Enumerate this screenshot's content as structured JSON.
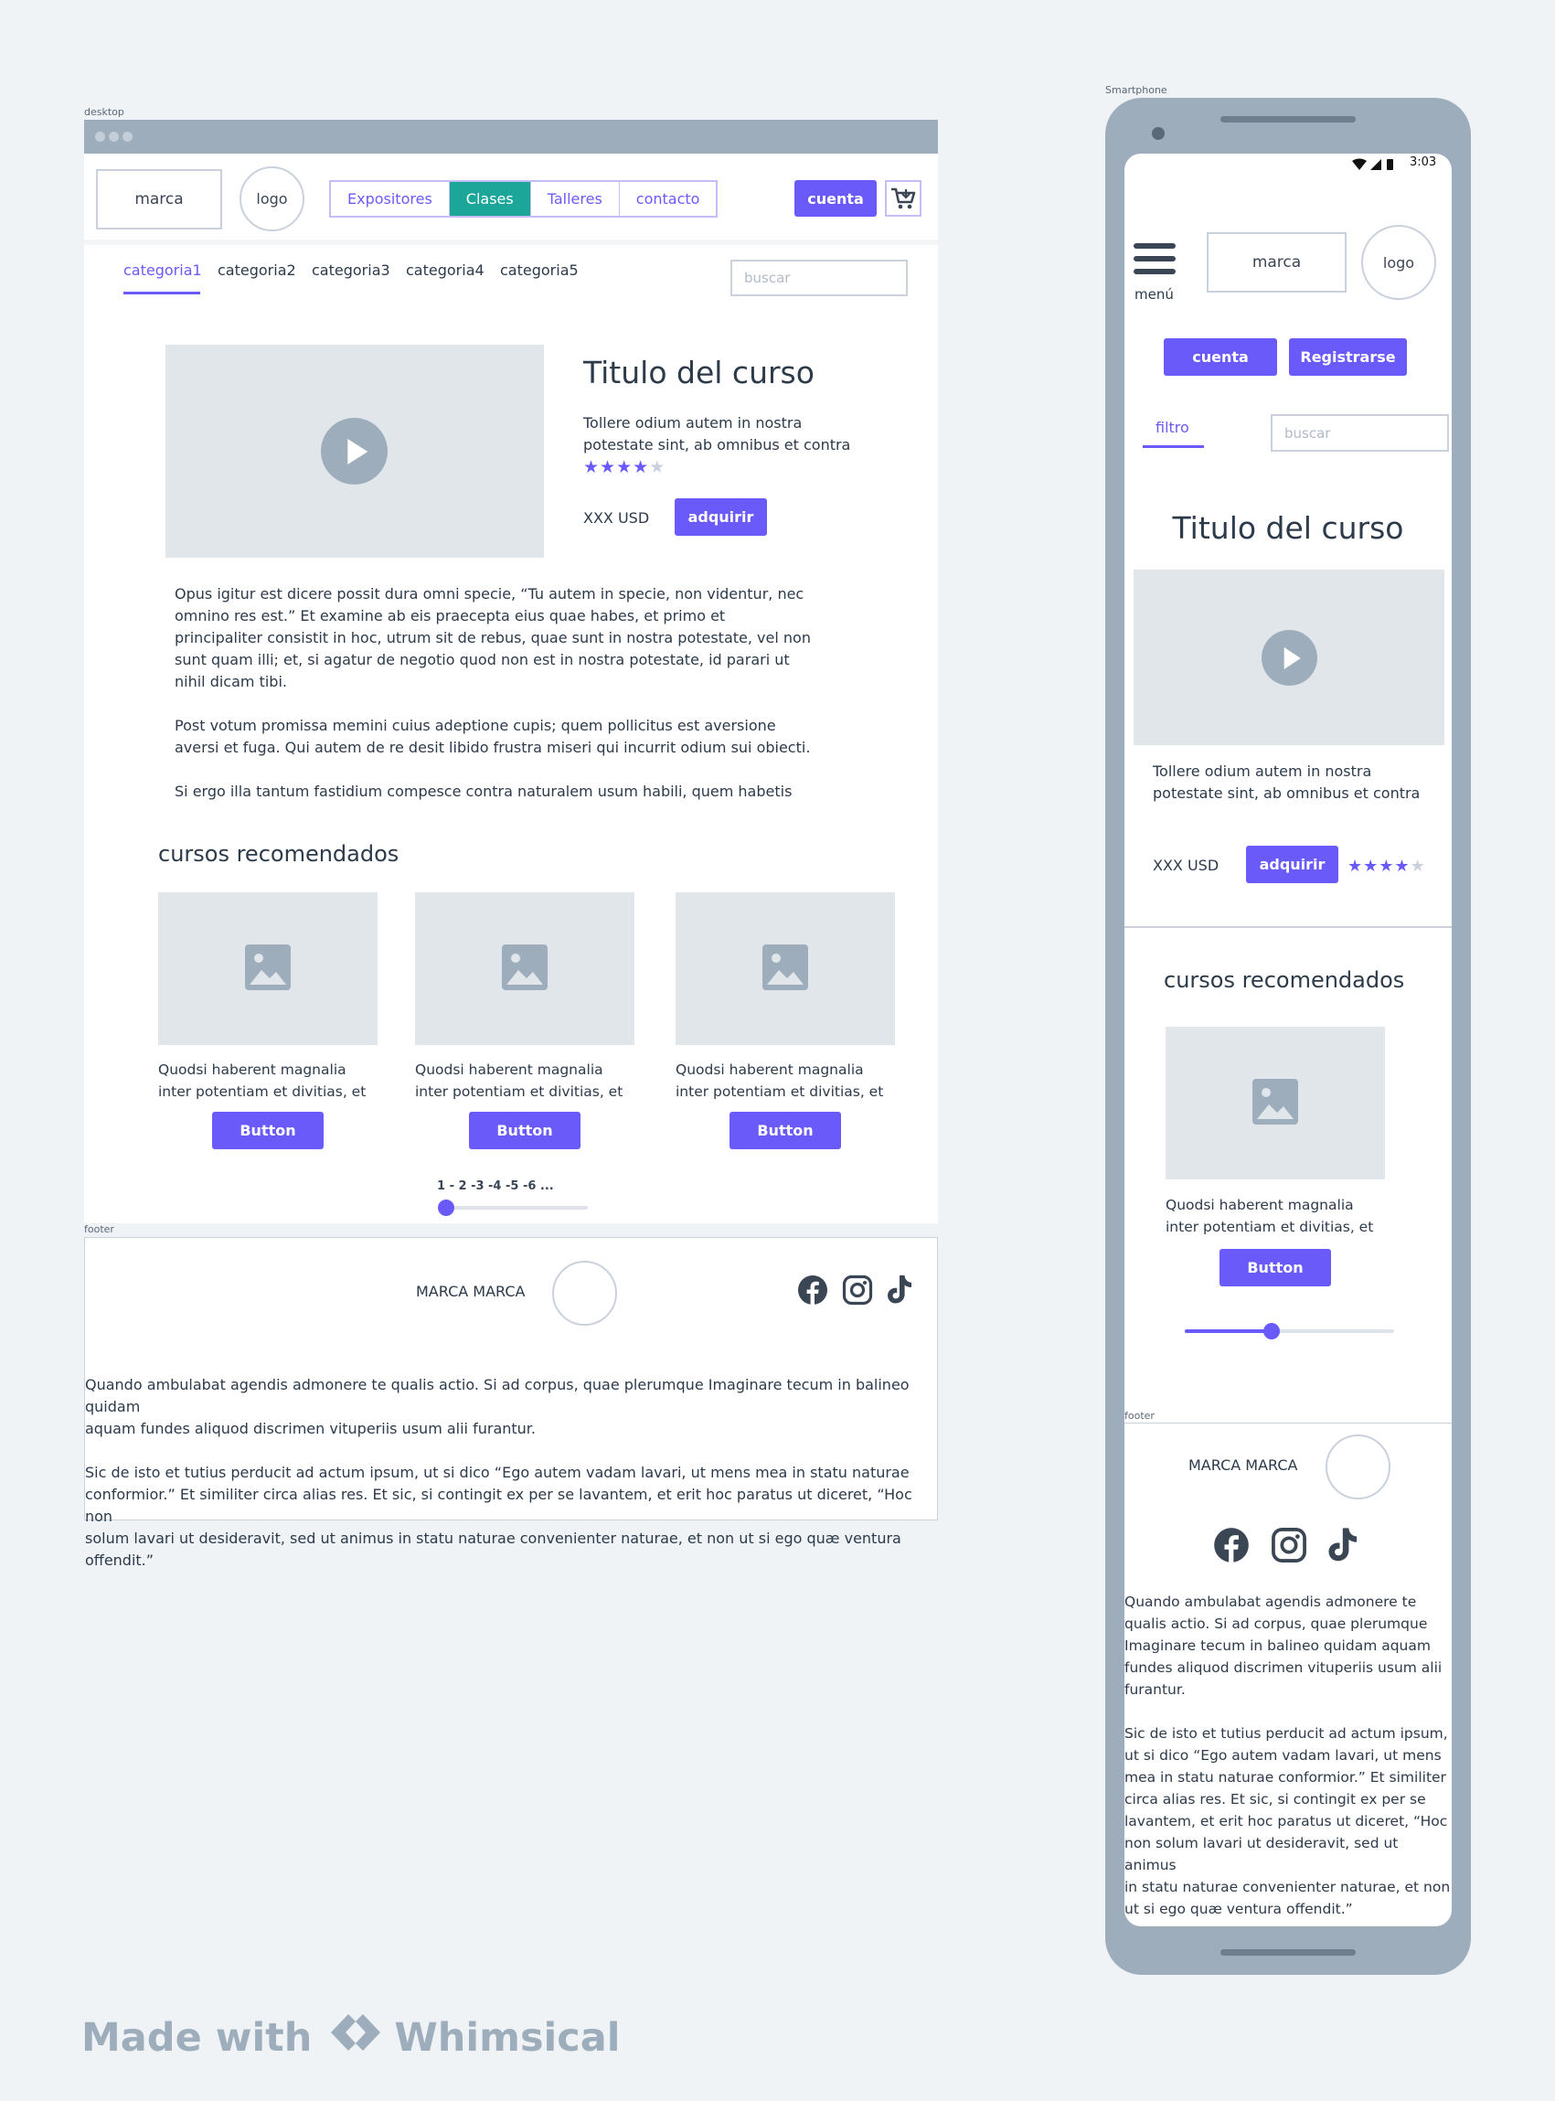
{
  "desktop": {
    "frame_label": "desktop",
    "brand": "marca",
    "logo": "logo",
    "nav_tabs": [
      {
        "label": "Expositores",
        "active": false
      },
      {
        "label": "Clases",
        "active": true
      },
      {
        "label": "Talleres",
        "active": false
      },
      {
        "label": "contacto",
        "active": false
      }
    ],
    "account_button": "cuenta",
    "cart_icon": "cart-icon",
    "categories": [
      "categoria1",
      "categoria2",
      "categoria3",
      "categoria4",
      "categoria5"
    ],
    "active_category": "categoria1",
    "search_placeholder": "buscar",
    "course": {
      "title": "Titulo del curso",
      "subtitle_line1": "Tollere odium autem in nostra",
      "subtitle_line2": "potestate sint, ab omnibus et contra",
      "rating": 4,
      "rating_max": 5,
      "price": "XXX USD",
      "buy_button": "adquirir",
      "description_p1": [
        "Opus igitur est dicere possit dura omni specie, “Tu autem in specie, non videntur, nec",
        "omnino res est.” Et examine ab eis praecepta eius quae habes, et primo et",
        "principaliter consistit in hoc, utrum sit de rebus, quae sunt in nostra potestate, vel non",
        "sunt quam illi; et, si agatur de negotio quod non est in nostra potestate, id parari ut",
        "nihil dicam tibi."
      ],
      "description_p2": [
        "Post votum promissa memini cuius adeptione cupis; quem pollicitus est aversione",
        "aversi et fuga. Qui autem de re desit libido frustra miseri qui incurrit odium sui obiecti."
      ],
      "description_p3": [
        "Si ergo illa tantum fastidium compesce contra naturalem usum habili, quem habetis"
      ]
    },
    "recommended": {
      "heading": "cursos recomendados",
      "cards": [
        {
          "line1": "Quodsi haberent magnalia",
          "line2": "inter potentiam et divitias, et",
          "button": "Button"
        },
        {
          "line1": "Quodsi haberent magnalia",
          "line2": "inter potentiam et divitias, et",
          "button": "Button"
        },
        {
          "line1": "Quodsi haberent magnalia",
          "line2": "inter potentiam et divitias, et",
          "button": "Button"
        }
      ],
      "pagination": "1 - 2 -3 -4 -5 -6 ...",
      "slider_value": 0
    },
    "footer": {
      "label": "footer",
      "brand": "MARCA MARCA",
      "social_icons": [
        "facebook-icon",
        "instagram-icon",
        "tiktok-icon"
      ],
      "p1": [
        "Quando ambulabat agendis admonere te qualis actio. Si ad corpus, quae plerumque Imaginare tecum in balineo quidam",
        "aquam fundes aliquod discrimen vituperiis usum alii furantur."
      ],
      "p2": [
        "Sic de isto et tutius perducit ad actum ipsum, ut si dico “Ego autem vadam lavari, ut mens mea in statu naturae",
        "conformior.” Et similiter circa alias res. Et sic, si contingit ex per se lavantem, et erit hoc paratus ut diceret, “Hoc non",
        "solum lavari ut desideravit, sed ut animus in statu naturae convenienter naturae, et non ut si ego quæ ventura offendit.”"
      ]
    }
  },
  "phone": {
    "frame_label": "Smartphone",
    "time": "3:03",
    "menu_label": "menú",
    "brand": "marca",
    "logo": "logo",
    "account_button": "cuenta",
    "register_button": "Registrarse",
    "filter_tab": "filtro",
    "search_placeholder": "buscar",
    "course": {
      "title": "Titulo del curso",
      "subtitle_line1": "Tollere odium autem in nostra",
      "subtitle_line2": "potestate sint, ab omnibus et contra",
      "price": "XXX USD",
      "buy_button": "adquirir",
      "rating": 4,
      "rating_max": 5
    },
    "recommended": {
      "heading": "cursos recomendados",
      "card_line1": "Quodsi haberent magnalia",
      "card_line2": "inter potentiam et divitias, et",
      "button": "Button",
      "slider_value": 0.42
    },
    "footer": {
      "label": "footer",
      "brand": "MARCA MARCA",
      "p1": [
        "Quando ambulabat agendis admonere te",
        "qualis actio. Si ad corpus, quae plerumque",
        "Imaginare tecum in balineo quidam aquam",
        "fundes aliquod discrimen vituperiis usum alii",
        "furantur."
      ],
      "p2": [
        "Sic de isto et tutius perducit ad actum ipsum,",
        "ut si dico “Ego autem vadam lavari, ut mens",
        "mea in statu naturae conformior.” Et similiter",
        "circa alias res. Et sic, si contingit ex per se",
        "lavantem, et erit hoc paratus ut diceret, “Hoc",
        "non solum lavari ut desideravit, sed ut animus",
        "in statu naturae convenienter naturae, et non",
        "ut si ego quæ ventura offendit.”"
      ]
    }
  },
  "watermark": {
    "made_with": "Made with",
    "brand": "Whimsical"
  },
  "colors": {
    "accent": "#6a5af9",
    "active_tab": "#1ba699",
    "chrome": "#9eadbb",
    "background": "#eff3f6"
  }
}
